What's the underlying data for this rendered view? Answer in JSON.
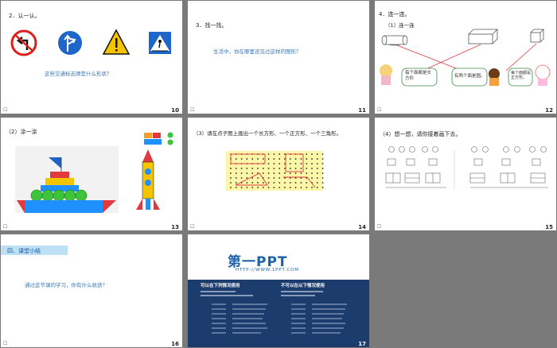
{
  "slides": [
    {
      "num": "10",
      "title": "2．认一认。",
      "question": "这些交通标志牌是什么形状？"
    },
    {
      "num": "11",
      "title": "3．找一找。",
      "question": "生活中，你在哪里还见过这样的图形？"
    },
    {
      "num": "12",
      "title": "4．连一连。",
      "sub": "（1）连一连",
      "b1": "每个面都是长方形",
      "b2": "有两个面是圆。",
      "b3": "每个面都是正方形。"
    },
    {
      "num": "13",
      "title": "（2）涂一涂"
    },
    {
      "num": "14",
      "title": "（3）请在点子图上画出一个长方形、一个正方形、一个三角形。"
    },
    {
      "num": "15",
      "title": "（4）想一想，请你接着画下去。"
    },
    {
      "num": "16",
      "title": "四、课堂小结",
      "question": "通过这节课的学习，你有什么收获？"
    },
    {
      "num": "17",
      "logo": "第一PPT",
      "url": "HTTP://WWW.1PPT.COM",
      "can_title": "可以在下列情况使用",
      "cannot_title": "不可以在以下情况使用"
    }
  ],
  "colors": {
    "accent": "#3a78b8",
    "bg": "#7a7a7a"
  }
}
